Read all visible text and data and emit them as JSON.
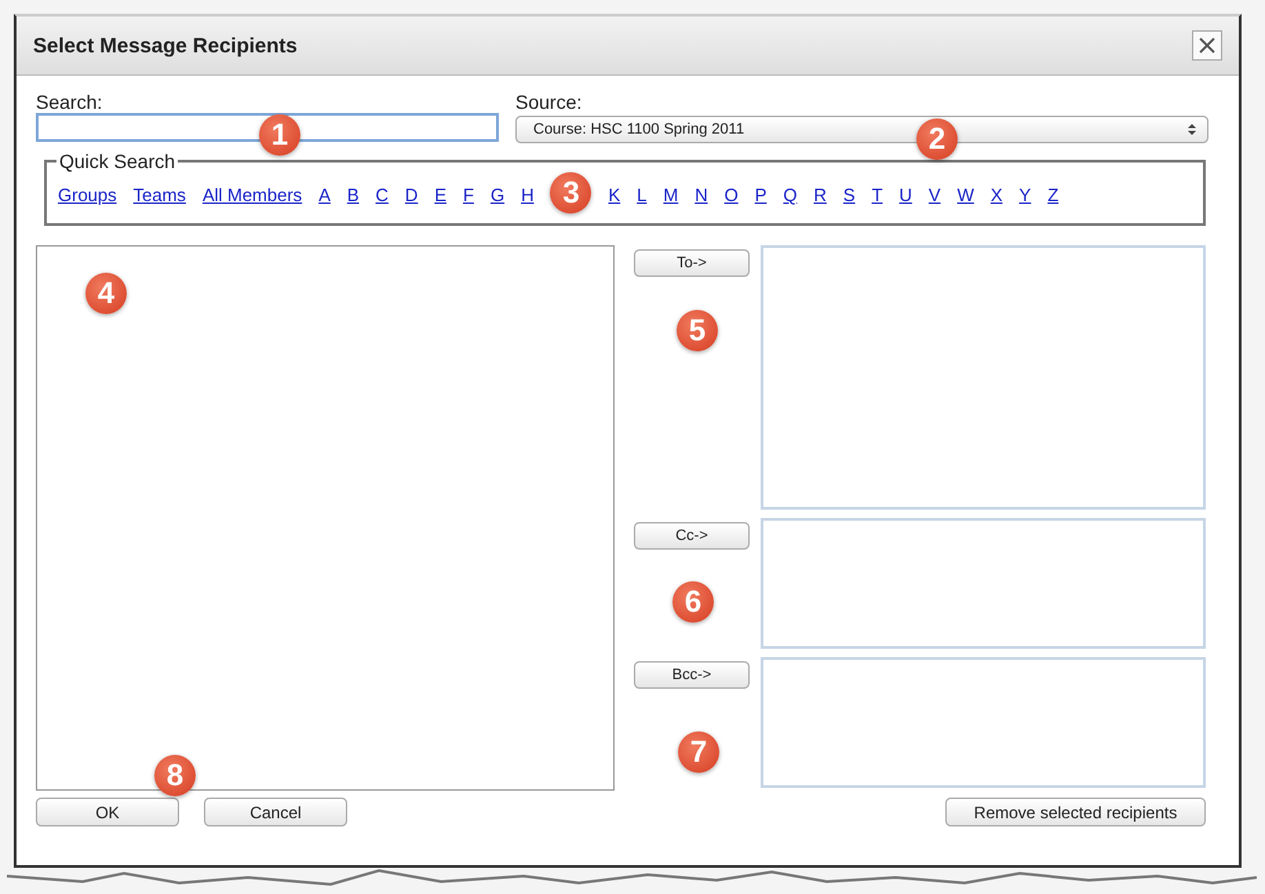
{
  "dialog": {
    "title": "Select Message Recipients"
  },
  "search": {
    "label": "Search:"
  },
  "source": {
    "label": "Source:",
    "value": "Course: HSC 1100 Spring 2011"
  },
  "quick_search": {
    "legend": "Quick Search",
    "links": [
      "Groups",
      "Teams",
      "All Members",
      "A",
      "B",
      "C",
      "D",
      "E",
      "F",
      "G",
      "H",
      "K",
      "L",
      "M",
      "N",
      "O",
      "P",
      "Q",
      "R",
      "S",
      "T",
      "U",
      "V",
      "W",
      "X",
      "Y",
      "Z"
    ]
  },
  "recipient_buttons": [
    "To->",
    "Cc->",
    "Bcc->"
  ],
  "remove_button": "Remove selected recipients",
  "footer_buttons": [
    "OK",
    "Cancel"
  ],
  "callouts": [
    "1",
    "2",
    "3",
    "4",
    "5",
    "6",
    "7",
    "8"
  ]
}
